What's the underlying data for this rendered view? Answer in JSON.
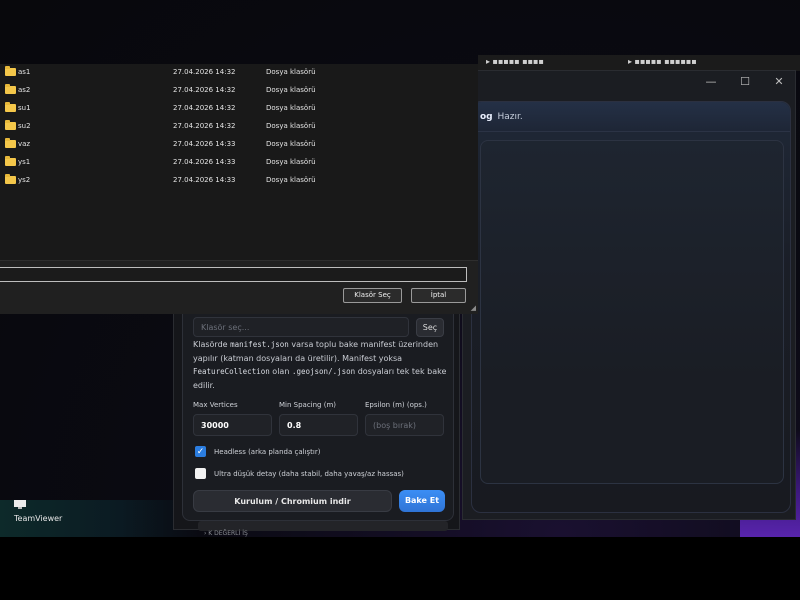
{
  "dialog": {
    "rows": [
      {
        "name": "as1",
        "date": "27.04.2026 14:32",
        "type": "Dosya klasörü"
      },
      {
        "name": "as2",
        "date": "27.04.2026 14:32",
        "type": "Dosya klasörü"
      },
      {
        "name": "su1",
        "date": "27.04.2026 14:32",
        "type": "Dosya klasörü"
      },
      {
        "name": "su2",
        "date": "27.04.2026 14:32",
        "type": "Dosya klasörü"
      },
      {
        "name": "vaz",
        "date": "27.04.2026 14:33",
        "type": "Dosya klasörü"
      },
      {
        "name": "ys1",
        "date": "27.04.2026 14:33",
        "type": "Dosya klasörü"
      },
      {
        "name": "ys2",
        "date": "27.04.2026 14:33",
        "type": "Dosya klasörü"
      }
    ],
    "path_value": "",
    "select_folder_label": "Klasör Seç",
    "cancel_label": "İptal"
  },
  "log_window": {
    "title": "og",
    "status": "Hazır.",
    "controls": [
      "—",
      "☐",
      "✕"
    ]
  },
  "bake_panel": {
    "folder_placeholder": "Klasör seç...",
    "pick_label": "Seç",
    "description": {
      "p1": "Klasörde ",
      "c1": "manifest.json",
      "p2": " varsa toplu bake manifest üzerinden yapılır (katman dosyaları da üretilir). Manifest yoksa ",
      "c2": "FeatureCollection",
      "p3": " olan ",
      "c3": ".geojson/.json",
      "p4": " dosyaları tek tek bake edilir."
    },
    "max_vertices": {
      "label": "Max Vertices",
      "value": "30000"
    },
    "min_spacing": {
      "label": "Min Spacing (m)",
      "value": "0.8"
    },
    "epsilon": {
      "label": "Epsilon (m) (ops.)",
      "placeholder": "(boş bırak)"
    },
    "headless": {
      "label": "Headless (arka planda çalıştır)",
      "checked": true
    },
    "ultra_low": {
      "label": "Ultra düşük detay (daha stabil, daha yavaş/az hassas)",
      "checked": false
    },
    "setup_label": "Kurulum / Chromium indir",
    "bake_label": "Bake Et"
  },
  "desktop": {
    "teamviewer_label": "TeamViewer"
  },
  "partial_text": {
    "tree": "› K DEĞERLİ İŞ"
  },
  "colors": {
    "accent": "#2f74d6",
    "folder": "#f4c74a"
  }
}
